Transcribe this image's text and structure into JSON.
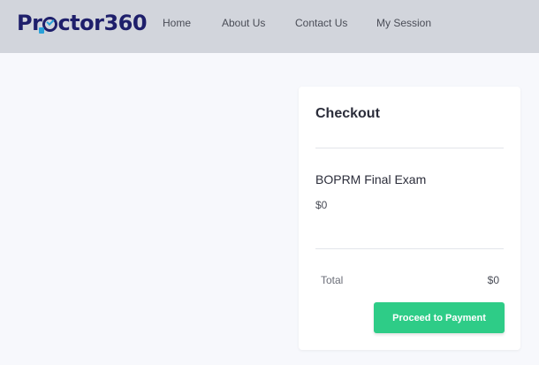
{
  "brand": {
    "logo_prefix": "Pr",
    "logo_suffix": "ctor360",
    "colors": {
      "navy": "#1e1f6b",
      "accent": "#2aa1d8"
    }
  },
  "nav": {
    "items": [
      {
        "label": "Home"
      },
      {
        "label": "About Us"
      },
      {
        "label": "Contact Us"
      },
      {
        "label": "My Session"
      }
    ]
  },
  "checkout": {
    "title": "Checkout",
    "item": {
      "name": "BOPRM Final Exam",
      "price": "$0"
    },
    "total_label": "Total",
    "total_value": "$0",
    "button_label": "Proceed to Payment",
    "button_color": "#2ecc87"
  }
}
